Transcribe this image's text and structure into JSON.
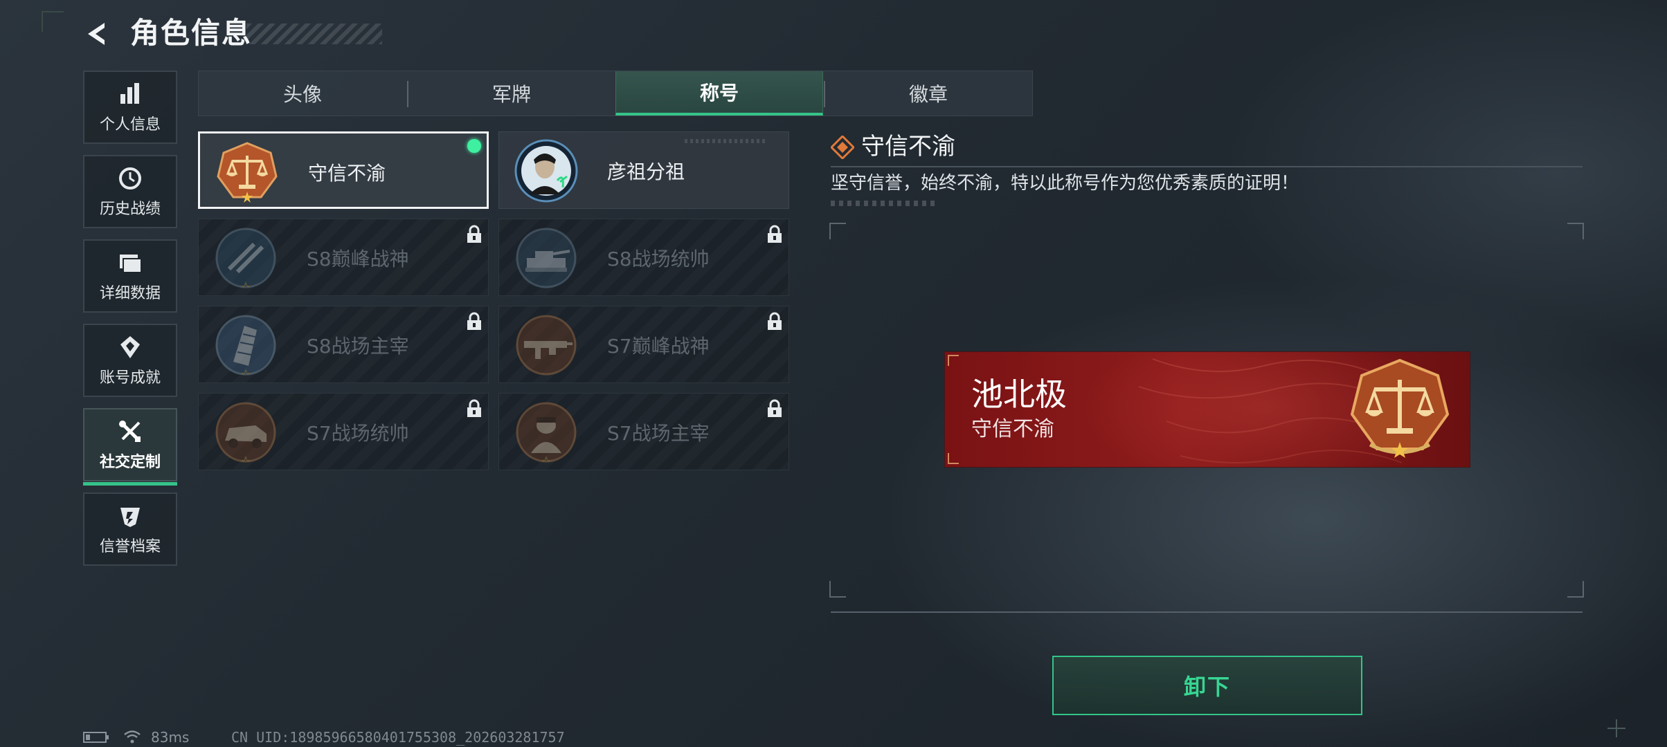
{
  "header": {
    "title": "角色信息"
  },
  "nav": {
    "items": [
      {
        "label": "个人信息",
        "icon": "bar-chart-icon"
      },
      {
        "label": "历史战绩",
        "icon": "history-clock-icon"
      },
      {
        "label": "详细数据",
        "icon": "folder-icon"
      },
      {
        "label": "账号成就",
        "icon": "achievement-icon"
      },
      {
        "label": "社交定制",
        "icon": "wrench-tools-icon"
      },
      {
        "label": "信誉档案",
        "icon": "credit-shield-icon"
      }
    ],
    "active_index": 4
  },
  "tabs": {
    "items": [
      {
        "label": "头像"
      },
      {
        "label": "军牌"
      },
      {
        "label": "称号"
      },
      {
        "label": "徽章"
      }
    ],
    "active_index": 2
  },
  "titles": [
    {
      "label": "守信不渝",
      "state": "selected",
      "icon": "scales-emblem-icon"
    },
    {
      "label": "彦祖分祖",
      "state": "unlocked",
      "icon": "portrait-emblem-icon"
    },
    {
      "label": "S8巅峰战神",
      "state": "locked",
      "icon": "stripes-emblem-icon"
    },
    {
      "label": "S8战场统帅",
      "state": "locked",
      "icon": "tank-emblem-icon"
    },
    {
      "label": "S8战场主宰",
      "state": "locked",
      "icon": "tower-emblem-icon"
    },
    {
      "label": "S7巅峰战神",
      "state": "locked",
      "icon": "rifle-emblem-icon"
    },
    {
      "label": "S7战场统帅",
      "state": "locked",
      "icon": "vehicle-emblem-icon"
    },
    {
      "label": "S7战场主宰",
      "state": "locked",
      "icon": "soldier-emblem-icon"
    }
  ],
  "detail": {
    "name": "守信不渝",
    "description": "坚守信誉，始终不渝，特以此称号作为您优秀素质的证明！",
    "nameplate": {
      "player_name": "池北极",
      "title": "守信不渝"
    },
    "action_label": "卸下"
  },
  "status": {
    "ping": "83ms",
    "uid": "CN UID:18985966580401755308_202603281757"
  },
  "colors": {
    "accent": "#36c38a",
    "selected_dot": "#3ef0a0",
    "nameplate_red": "#8e1c1c",
    "emblem_orange": "#c0652c",
    "text_locked": "#5e676e"
  }
}
